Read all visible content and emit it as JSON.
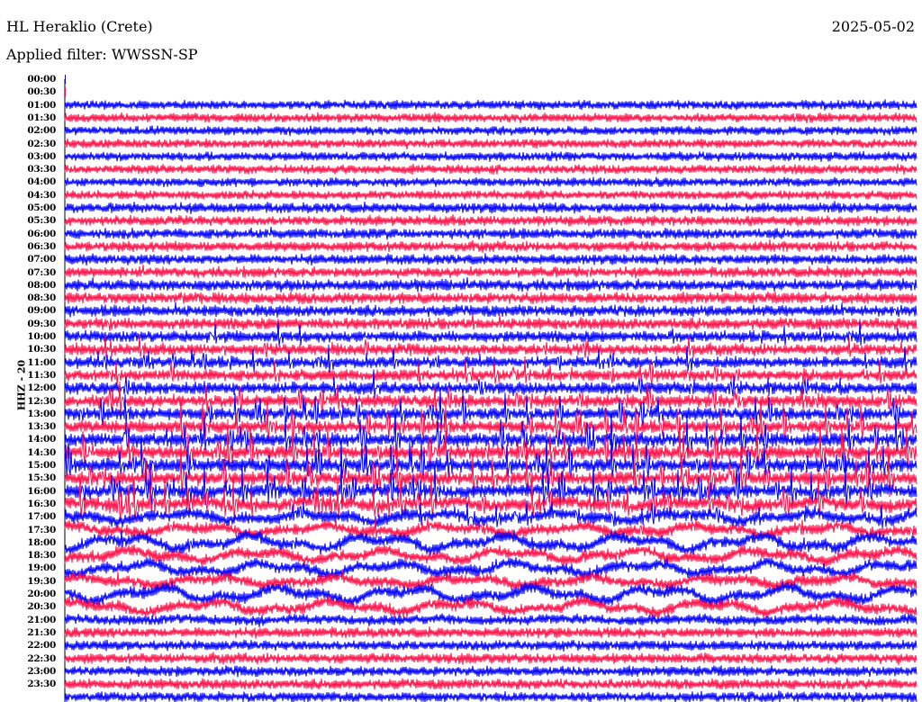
{
  "header": {
    "station": "HL Heraklio (Crete)",
    "date": "2025-05-02",
    "filter": "Applied filter: WWSSN-SP"
  },
  "chart_data": {
    "type": "helicorder",
    "title": "HL Heraklio (Crete)",
    "ylabel": "HHZ - 20",
    "row_minutes": 30,
    "tick_labels": [
      "00:00",
      "00:30",
      "01:00",
      "01:30",
      "02:00",
      "02:30",
      "03:00",
      "03:30",
      "04:00",
      "04:30",
      "05:00",
      "05:30",
      "06:00",
      "06:30",
      "07:00",
      "07:30",
      "08:00",
      "08:30",
      "09:00",
      "09:30",
      "10:00",
      "10:30",
      "11:00",
      "11:30",
      "12:00",
      "12:30",
      "13:00",
      "13:30",
      "14:00",
      "14:30",
      "15:00",
      "15:30",
      "16:00",
      "16:30",
      "17:00",
      "17:30",
      "18:00",
      "18:30",
      "19:00",
      "19:30",
      "20:00",
      "20:30",
      "21:00",
      "21:30",
      "22:00",
      "22:30",
      "23:00",
      "23:30"
    ],
    "colors": [
      "#0000ff",
      "#ff1048"
    ],
    "noise_level": [
      0,
      0,
      4,
      4,
      4,
      4,
      4,
      4,
      4,
      4,
      4.5,
      4.5,
      4.5,
      4.5,
      4.5,
      4.5,
      5,
      5,
      5,
      5,
      5,
      5,
      5,
      5,
      5.5,
      5.5,
      5.5,
      5.5,
      6,
      6,
      6,
      6,
      6,
      6,
      5.5,
      5,
      5,
      5,
      5,
      5,
      5,
      5,
      4.5,
      4.5,
      4.5,
      4.5,
      4.5,
      4.5,
      4.5
    ],
    "event_level": [
      0,
      0,
      0,
      0,
      0,
      0,
      0,
      0,
      0,
      0,
      0.1,
      0.1,
      0.15,
      0.15,
      0.15,
      0.2,
      0.2,
      0.25,
      0.3,
      0.3,
      0.4,
      0.45,
      0.5,
      0.55,
      0.6,
      0.7,
      0.8,
      0.9,
      1,
      1,
      1,
      1,
      1,
      0.9,
      0.5,
      0.35,
      0.25,
      0.2,
      0.2,
      0.2,
      0.2,
      0.15,
      0.1,
      0.05,
      0.05,
      0.05,
      0.05,
      0.05,
      0.05
    ],
    "drift_level": [
      0,
      0,
      0,
      0,
      0,
      0,
      0,
      0,
      0,
      0,
      0,
      0,
      0,
      0,
      0,
      0,
      0,
      0,
      0,
      0,
      0,
      0,
      0,
      0,
      0,
      0,
      0,
      0,
      0,
      0,
      0,
      0,
      1,
      2,
      3,
      3,
      5,
      4,
      4,
      3,
      5,
      4,
      1,
      0,
      0,
      0,
      0,
      0,
      0
    ]
  }
}
